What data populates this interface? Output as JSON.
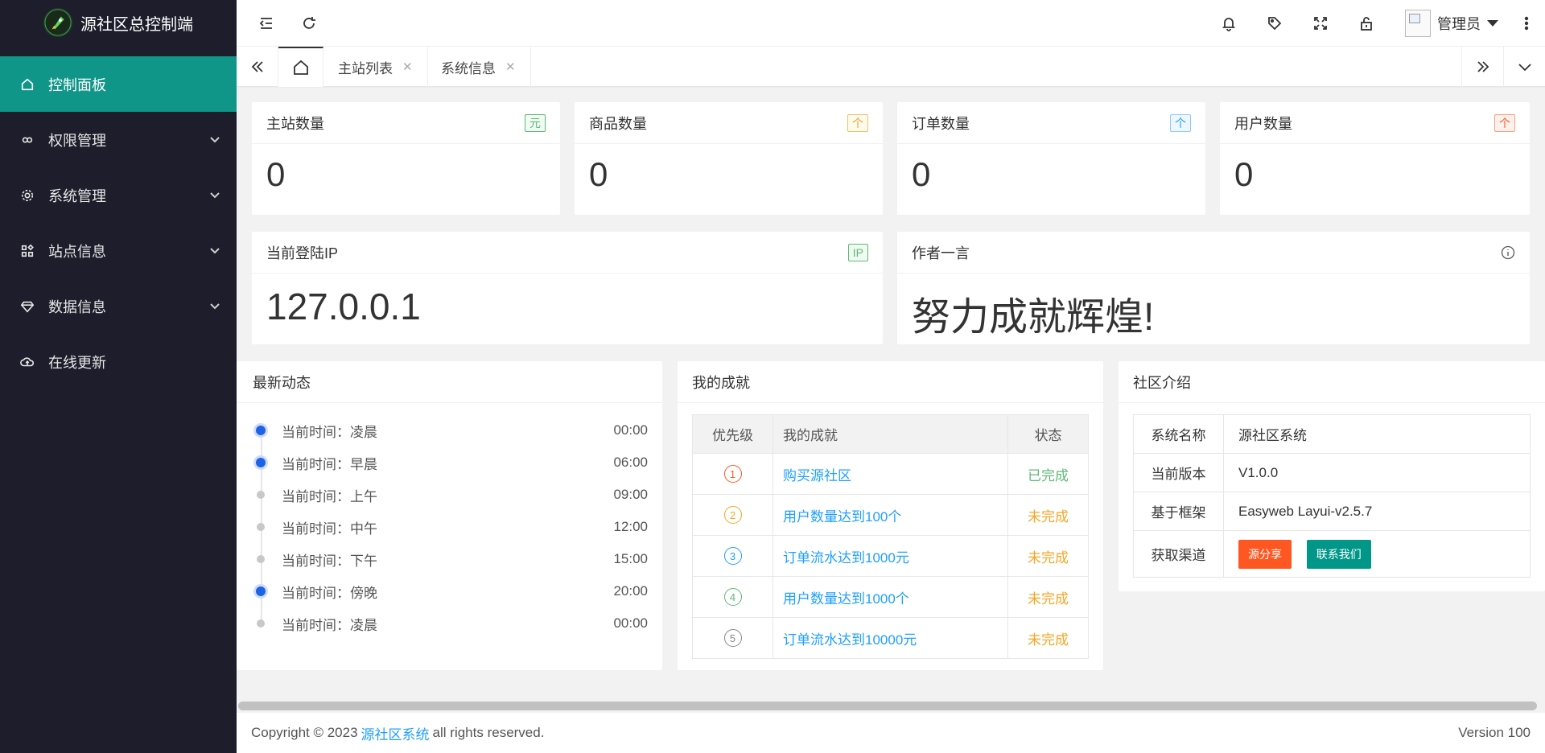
{
  "app": {
    "title": "源社区总控制端"
  },
  "sidebar": {
    "items": [
      {
        "label": "控制面板",
        "icon": "home-icon"
      },
      {
        "label": "权限管理",
        "icon": "link-icon"
      },
      {
        "label": "系统管理",
        "icon": "gear-icon"
      },
      {
        "label": "站点信息",
        "icon": "apps-icon"
      },
      {
        "label": "数据信息",
        "icon": "diamond-icon"
      },
      {
        "label": "在线更新",
        "icon": "cloud-icon"
      }
    ]
  },
  "header": {
    "user_name": "管理员"
  },
  "tabs": [
    {
      "label": "主站列表"
    },
    {
      "label": "系统信息"
    }
  ],
  "stats": [
    {
      "label": "主站数量",
      "badge": "元",
      "value": "0"
    },
    {
      "label": "商品数量",
      "badge": "个",
      "value": "0"
    },
    {
      "label": "订单数量",
      "badge": "个",
      "value": "0"
    },
    {
      "label": "用户数量",
      "badge": "个",
      "value": "0"
    }
  ],
  "ip_card": {
    "label": "当前登陆IP",
    "badge": "IP",
    "value": "127.0.0.1"
  },
  "author_card": {
    "label": "作者一言",
    "value": "努力成就辉煌!"
  },
  "timeline": {
    "title": "最新动态",
    "items": [
      {
        "text": "当前时间：凌晨",
        "time": "00:00",
        "active": true
      },
      {
        "text": "当前时间：早晨",
        "time": "06:00",
        "active": true
      },
      {
        "text": "当前时间：上午",
        "time": "09:00",
        "active": false
      },
      {
        "text": "当前时间：中午",
        "time": "12:00",
        "active": false
      },
      {
        "text": "当前时间：下午",
        "time": "15:00",
        "active": false
      },
      {
        "text": "当前时间：傍晚",
        "time": "20:00",
        "active": true
      },
      {
        "text": "当前时间：凌晨",
        "time": "00:00",
        "active": false
      }
    ]
  },
  "achievements": {
    "title": "我的成就",
    "headers": [
      "优先级",
      "我的成就",
      "状态"
    ],
    "rows": [
      {
        "rank": "1",
        "name": "购买源社区",
        "status": "已完成",
        "color": "#ff5722"
      },
      {
        "rank": "2",
        "name": "用户数量达到100个",
        "status": "未完成",
        "color": "#f5a623"
      },
      {
        "rank": "3",
        "name": "订单流水达到1000元",
        "status": "未完成",
        "color": "#1e9fff"
      },
      {
        "rank": "4",
        "name": "用户数量达到1000个",
        "status": "未完成",
        "color": "#5fb878"
      },
      {
        "rank": "5",
        "name": "订单流水达到10000元",
        "status": "未完成",
        "color": "#888888"
      }
    ]
  },
  "intro": {
    "title": "社区介绍",
    "rows": [
      {
        "key": "系统名称",
        "value": "源社区系统"
      },
      {
        "key": "当前版本",
        "value": "V1.0.0"
      },
      {
        "key": "基于框架",
        "value": "Easyweb Layui-v2.5.7"
      }
    ],
    "channel_key": "获取渠道",
    "btn_share": "源分享",
    "btn_contact": "联系我们"
  },
  "footer": {
    "copyright": "Copyright © 2023",
    "link": "源社区系统",
    "rights": "all rights reserved.",
    "version": "Version 100"
  }
}
